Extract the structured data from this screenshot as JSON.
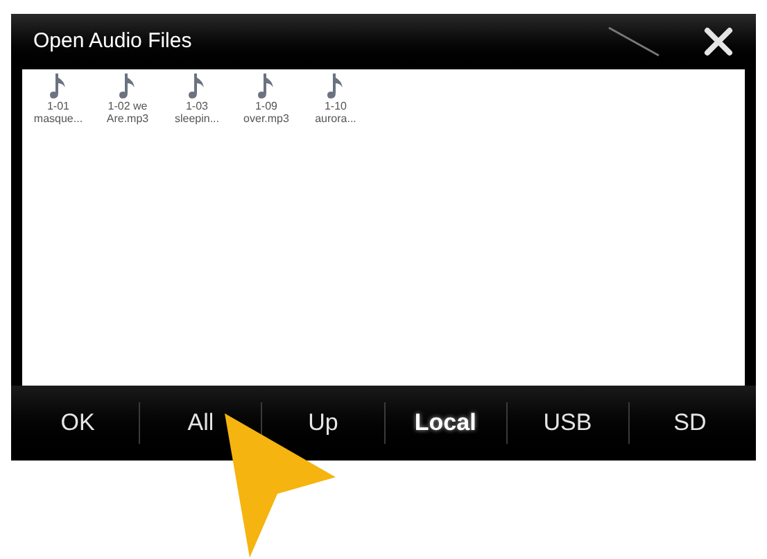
{
  "window": {
    "title": "Open Audio Files"
  },
  "files": [
    {
      "line_1": "1-01",
      "line_2": "masque..."
    },
    {
      "line_1": "1-02 we",
      "line_2": "Are.mp3"
    },
    {
      "line_1": "1-03",
      "line_2": "sleepin..."
    },
    {
      "line_1": "1-09",
      "line_2": "over.mp3"
    },
    {
      "line_1": "1-10",
      "line_2": "aurora..."
    }
  ],
  "buttons": [
    {
      "label": "OK",
      "selected": false
    },
    {
      "label": "All",
      "selected": false
    },
    {
      "label": "Up",
      "selected": false
    },
    {
      "label": "Local",
      "selected": true
    },
    {
      "label": "USB",
      "selected": false
    },
    {
      "label": "SD",
      "selected": false
    }
  ]
}
